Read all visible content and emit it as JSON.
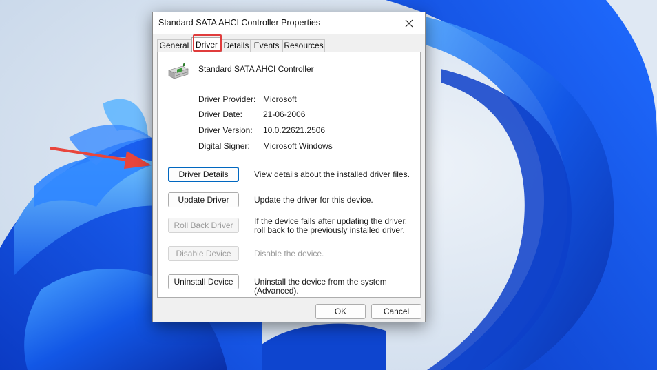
{
  "window": {
    "title": "Standard SATA AHCI Controller Properties"
  },
  "tabs": [
    {
      "label": "General"
    },
    {
      "label": "Driver",
      "active": true
    },
    {
      "label": "Details"
    },
    {
      "label": "Events"
    },
    {
      "label": "Resources"
    }
  ],
  "device": {
    "name": "Standard SATA AHCI Controller",
    "icon": "controller-icon"
  },
  "info": [
    {
      "label": "Driver Provider:",
      "value": "Microsoft"
    },
    {
      "label": "Driver Date:",
      "value": "21-06-2006"
    },
    {
      "label": "Driver Version:",
      "value": "10.0.22621.2506"
    },
    {
      "label": "Digital Signer:",
      "value": "Microsoft Windows"
    }
  ],
  "actions": [
    {
      "button": "Driver Details",
      "description": "View details about the installed driver files.",
      "enabled": true
    },
    {
      "button": "Update Driver",
      "description": "Update the driver for this device.",
      "enabled": true
    },
    {
      "button": "Roll Back Driver",
      "description": "If the device fails after updating the driver, roll back to the previously installed driver.",
      "enabled": false
    },
    {
      "button": "Disable Device",
      "description": "Disable the device.",
      "enabled": false
    },
    {
      "button": "Uninstall Device",
      "description": "Uninstall the device from the system (Advanced).",
      "enabled": true
    }
  ],
  "footer": {
    "ok_label": "OK",
    "cancel_label": "Cancel"
  },
  "icons": {
    "close": "close-icon",
    "annotation_arrow": "red-arrow-icon"
  },
  "colors": {
    "accent": "#0067c0",
    "highlight": "#e03c3c",
    "wallpaper": "#1f5fe0"
  }
}
